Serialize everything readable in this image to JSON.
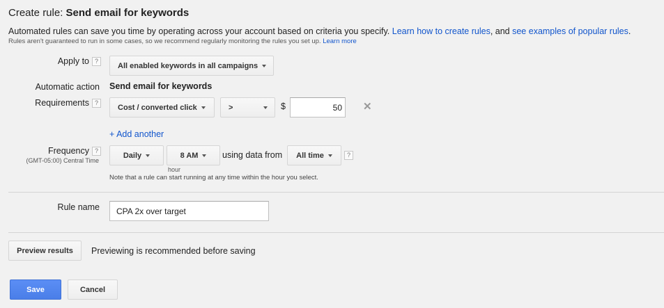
{
  "header": {
    "title_prefix": "Create rule:",
    "title_bold": "Send email for keywords"
  },
  "intro": {
    "text1": "Automated rules can save you time by operating across your account based on criteria you specify. ",
    "link1": "Learn how to create rules",
    "text2": ", and ",
    "link2": "see examples of popular rules",
    "text3": ".",
    "note": "Rules aren't guaranteed to run in some cases, so we recommend regularly monitoring the rules you set up. ",
    "note_link": "Learn more"
  },
  "help_glyph": "?",
  "apply_to": {
    "label": "Apply to",
    "value": "All enabled keywords in all campaigns"
  },
  "automatic_action": {
    "label": "Automatic action",
    "value": "Send email for keywords"
  },
  "requirements": {
    "label": "Requirements",
    "metric": "Cost / converted click",
    "operator": ">",
    "currency": "$",
    "amount": "50",
    "remove_glyph": "✕",
    "add_another": "+ Add another"
  },
  "frequency": {
    "label": "Frequency",
    "timezone": "(GMT-05:00) Central Time",
    "period": "Daily",
    "hour": "8 AM",
    "hour_caption": "hour",
    "using_data_text": "using data from",
    "data_range": "All time",
    "note": "Note that a rule can start running at any time within the hour you select."
  },
  "rule_name": {
    "label": "Rule name",
    "value": "CPA 2x over target"
  },
  "preview": {
    "button": "Preview results",
    "message": "Previewing is recommended before saving"
  },
  "actions": {
    "save": "Save",
    "cancel": "Cancel"
  },
  "colors": {
    "link": "#1155cc",
    "primary_button": "#4d87ee",
    "background": "#f1f1f1"
  }
}
